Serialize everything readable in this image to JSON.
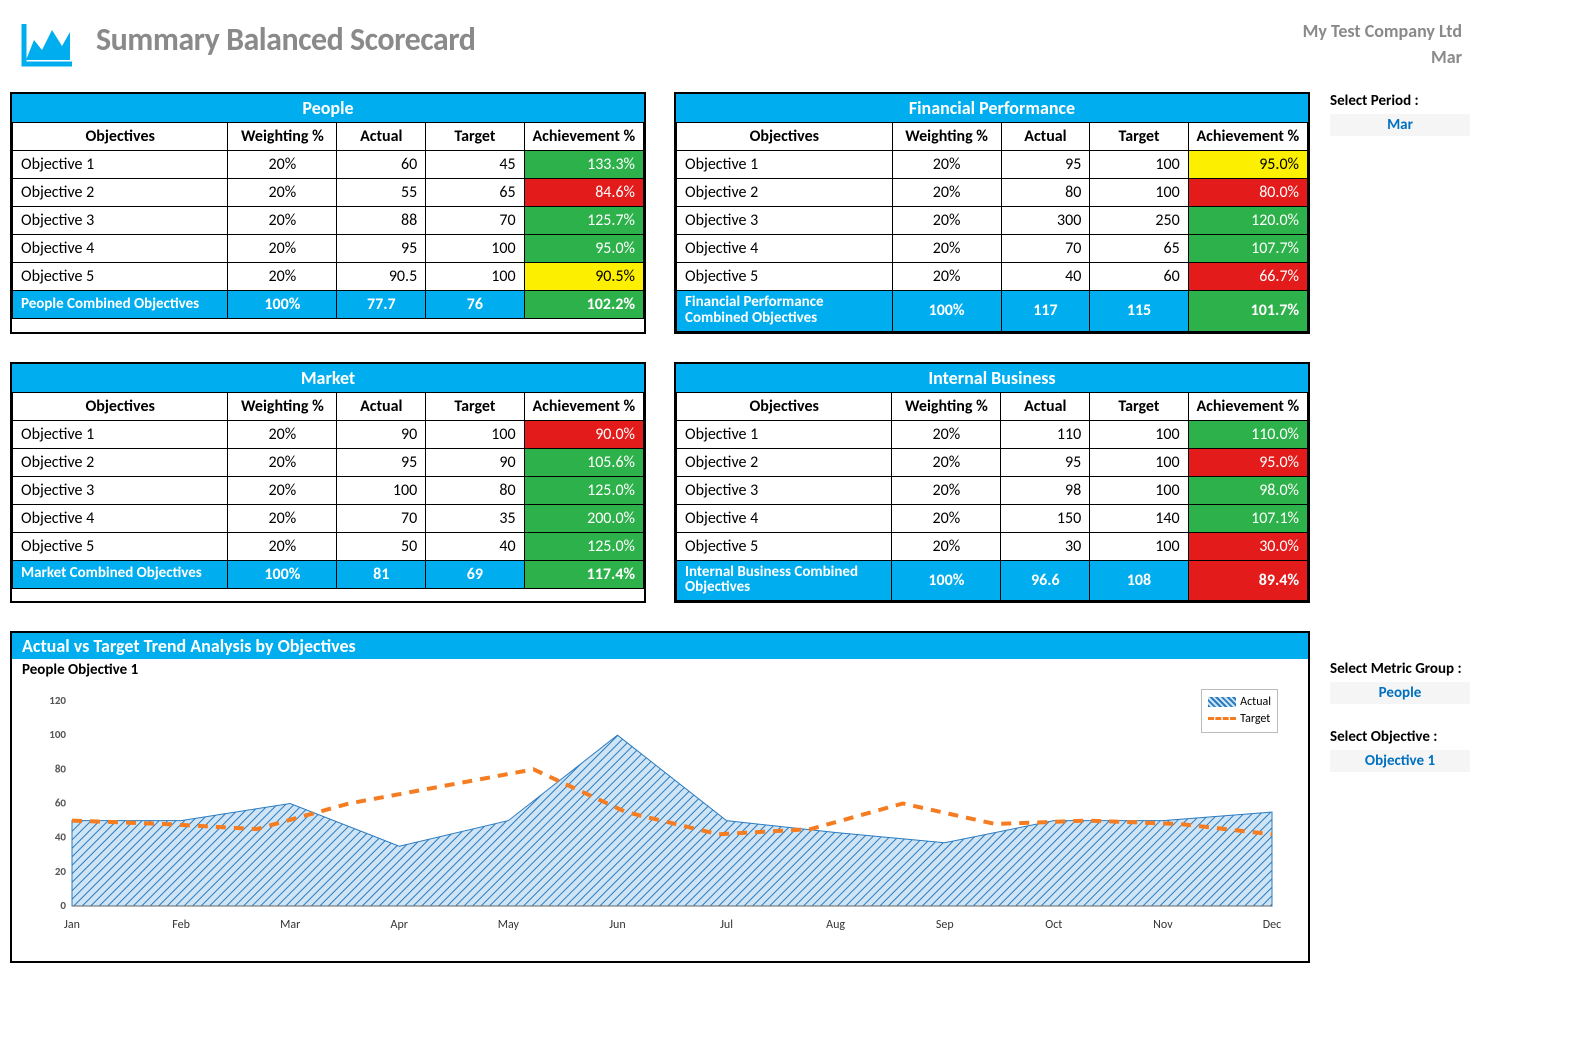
{
  "header": {
    "title": "Summary Balanced Scorecard",
    "company": "My Test Company Ltd",
    "period": "Mar"
  },
  "side": {
    "select_period_label": "Select Period :",
    "select_period_value": "Mar",
    "select_metric_label": "Select Metric Group :",
    "select_metric_value": "People",
    "select_objective_label": "Select Objective :",
    "select_objective_value": "Objective 1"
  },
  "columns": {
    "objectives": "Objectives",
    "weighting": "Weighting %",
    "actual": "Actual",
    "target": "Target",
    "achievement": "Achievement %"
  },
  "cards": {
    "people": {
      "title": "People",
      "rows": [
        {
          "obj": "Objective 1",
          "w": "20%",
          "a": "60",
          "t": "45",
          "acv": "133.3%",
          "cls": "green"
        },
        {
          "obj": "Objective 2",
          "w": "20%",
          "a": "55",
          "t": "65",
          "acv": "84.6%",
          "cls": "red"
        },
        {
          "obj": "Objective 3",
          "w": "20%",
          "a": "88",
          "t": "70",
          "acv": "125.7%",
          "cls": "green"
        },
        {
          "obj": "Objective 4",
          "w": "20%",
          "a": "95",
          "t": "100",
          "acv": "95.0%",
          "cls": "green"
        },
        {
          "obj": "Objective 5",
          "w": "20%",
          "a": "90.5",
          "t": "100",
          "acv": "90.5%",
          "cls": "yellow"
        }
      ],
      "total": {
        "obj": "People Combined Objectives",
        "w": "100%",
        "a": "77.7",
        "t": "76",
        "acv": "102.2%",
        "cls": "good"
      }
    },
    "financial": {
      "title": "Financial Performance",
      "rows": [
        {
          "obj": "Objective 1",
          "w": "20%",
          "a": "95",
          "t": "100",
          "acv": "95.0%",
          "cls": "yellow"
        },
        {
          "obj": "Objective 2",
          "w": "20%",
          "a": "80",
          "t": "100",
          "acv": "80.0%",
          "cls": "red"
        },
        {
          "obj": "Objective 3",
          "w": "20%",
          "a": "300",
          "t": "250",
          "acv": "120.0%",
          "cls": "green"
        },
        {
          "obj": "Objective 4",
          "w": "20%",
          "a": "70",
          "t": "65",
          "acv": "107.7%",
          "cls": "green"
        },
        {
          "obj": "Objective 5",
          "w": "20%",
          "a": "40",
          "t": "60",
          "acv": "66.7%",
          "cls": "red"
        }
      ],
      "total": {
        "obj": "Financial Performance Combined Objectives",
        "w": "100%",
        "a": "117",
        "t": "115",
        "acv": "101.7%",
        "cls": "good"
      }
    },
    "market": {
      "title": "Market",
      "rows": [
        {
          "obj": "Objective 1",
          "w": "20%",
          "a": "90",
          "t": "100",
          "acv": "90.0%",
          "cls": "red"
        },
        {
          "obj": "Objective 2",
          "w": "20%",
          "a": "95",
          "t": "90",
          "acv": "105.6%",
          "cls": "green"
        },
        {
          "obj": "Objective 3",
          "w": "20%",
          "a": "100",
          "t": "80",
          "acv": "125.0%",
          "cls": "green"
        },
        {
          "obj": "Objective 4",
          "w": "20%",
          "a": "70",
          "t": "35",
          "acv": "200.0%",
          "cls": "green"
        },
        {
          "obj": "Objective 5",
          "w": "20%",
          "a": "50",
          "t": "40",
          "acv": "125.0%",
          "cls": "green"
        }
      ],
      "total": {
        "obj": "Market Combined Objectives",
        "w": "100%",
        "a": "81",
        "t": "69",
        "acv": "117.4%",
        "cls": "good"
      }
    },
    "internal": {
      "title": "Internal Business",
      "rows": [
        {
          "obj": "Objective 1",
          "w": "20%",
          "a": "110",
          "t": "100",
          "acv": "110.0%",
          "cls": "green"
        },
        {
          "obj": "Objective 2",
          "w": "20%",
          "a": "95",
          "t": "100",
          "acv": "95.0%",
          "cls": "red"
        },
        {
          "obj": "Objective 3",
          "w": "20%",
          "a": "98",
          "t": "100",
          "acv": "98.0%",
          "cls": "green"
        },
        {
          "obj": "Objective 4",
          "w": "20%",
          "a": "150",
          "t": "140",
          "acv": "107.1%",
          "cls": "green"
        },
        {
          "obj": "Objective 5",
          "w": "20%",
          "a": "30",
          "t": "100",
          "acv": "30.0%",
          "cls": "red"
        }
      ],
      "total": {
        "obj": "Internal Business Combined Objectives",
        "w": "100%",
        "a": "96.6",
        "t": "108",
        "acv": "89.4%",
        "cls": "bad"
      }
    }
  },
  "chart": {
    "title": "Actual vs Target Trend Analysis by Objectives",
    "subtitle": "People Objective 1",
    "legend": {
      "actual": "Actual",
      "target": "Target"
    }
  },
  "chart_data": {
    "type": "area+line",
    "title": "Actual vs Target Trend Analysis by Objectives — People Objective 1",
    "xlabel": "",
    "ylabel": "",
    "ylim": [
      0,
      120
    ],
    "yticks": [
      0,
      20,
      40,
      60,
      80,
      100,
      120
    ],
    "categories": [
      "Jan",
      "Feb",
      "Mar",
      "Apr",
      "May",
      "Jun",
      "Jul",
      "Aug",
      "Sep",
      "Oct",
      "Nov",
      "Dec"
    ],
    "series": [
      {
        "name": "Actual",
        "type": "area",
        "values": [
          50,
          50,
          60,
          35,
          50,
          100,
          50,
          43,
          37,
          50,
          50,
          55
        ]
      },
      {
        "name": "Target",
        "type": "line_dashed",
        "values": [
          50,
          48,
          45,
          60,
          70,
          80,
          55,
          42,
          45,
          60,
          48,
          50,
          48,
          42
        ]
      }
    ]
  }
}
